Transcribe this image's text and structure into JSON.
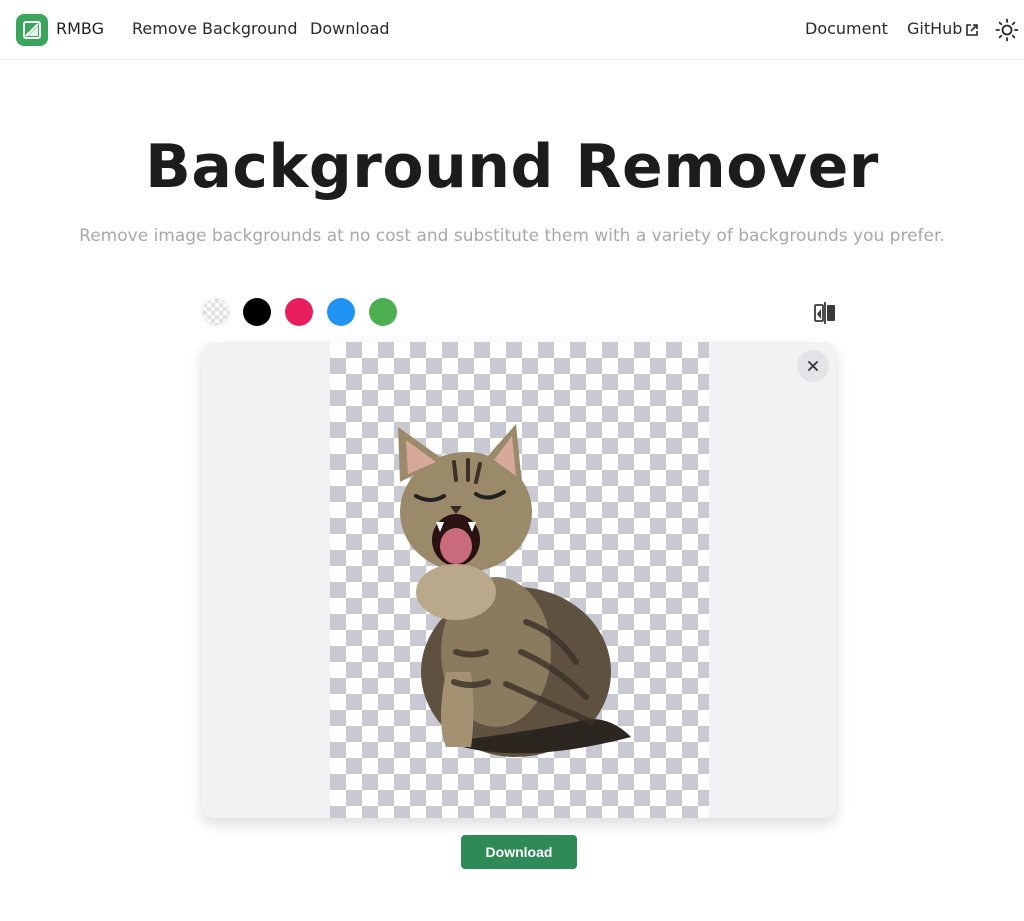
{
  "nav": {
    "brand": "RMBG",
    "links": [
      "Remove Background",
      "Download"
    ],
    "right_links": [
      "Document",
      "GitHub"
    ],
    "logo_icon": "logo-icon",
    "external_icon": "external-link-icon",
    "theme_icon": "sun-icon",
    "logo_color": "#3aa55d"
  },
  "hero": {
    "title": "Background Remover",
    "subtitle": "Remove image backgrounds at no cost and substitute them with a variety of backgrounds you prefer."
  },
  "swatches": [
    {
      "name": "transparent",
      "color": "transparent"
    },
    {
      "name": "black",
      "color": "#000000"
    },
    {
      "name": "pink",
      "color": "#e81e5f"
    },
    {
      "name": "blue",
      "color": "#2194f3"
    },
    {
      "name": "green",
      "color": "#4caf50"
    }
  ],
  "toolbar": {
    "compare_icon": "compare-icon"
  },
  "preview": {
    "close_icon": "close-icon",
    "subject": "kitten-with-removed-background"
  },
  "actions": {
    "download_label": "Download",
    "download_color": "#2e8b57"
  }
}
